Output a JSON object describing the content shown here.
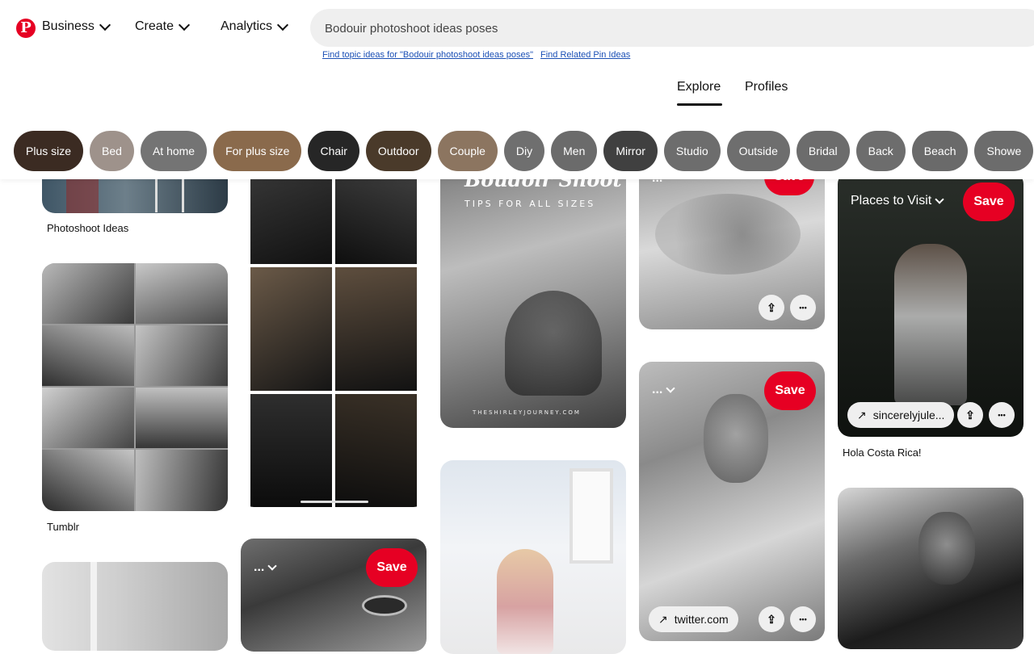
{
  "header": {
    "logo": "P",
    "nav": [
      {
        "label": "Business"
      },
      {
        "label": "Create"
      },
      {
        "label": "Analytics"
      }
    ],
    "search": {
      "value": "Bodouir photoshoot ideas poses"
    },
    "links": [
      "Find topic ideas for \"Bodouir photoshoot ideas poses\"",
      "Find Related Pin Ideas"
    ],
    "tabs": [
      "Explore",
      "Profiles"
    ]
  },
  "chips": [
    {
      "label": "Plus size",
      "color": "#3b2b22"
    },
    {
      "label": "Bed",
      "color": "#9e928b"
    },
    {
      "label": "At home",
      "color": "#747474"
    },
    {
      "label": "For plus size",
      "color": "#8a6a4c"
    },
    {
      "label": "Chair",
      "color": "#262626"
    },
    {
      "label": "Outdoor",
      "color": "#4a3a2a"
    },
    {
      "label": "Couple",
      "color": "#8c7560"
    },
    {
      "label": "Diy",
      "color": "#6f6f6f"
    },
    {
      "label": "Men",
      "color": "#6b6b6b"
    },
    {
      "label": "Mirror",
      "color": "#404040"
    },
    {
      "label": "Studio",
      "color": "#6d6d6d"
    },
    {
      "label": "Outside",
      "color": "#6e6e6e"
    },
    {
      "label": "Bridal",
      "color": "#6c6c6c"
    },
    {
      "label": "Back",
      "color": "#6d6d6d"
    },
    {
      "label": "Beach",
      "color": "#6a6a6a"
    },
    {
      "label": "Showe",
      "color": "#6c6c6c"
    }
  ],
  "pins": {
    "captions": {
      "photoshoot_ideas": "Photoshoot Ideas",
      "tumblr": "Tumblr",
      "hola": "Hola Costa Rica!"
    },
    "save_label": "Save",
    "board_label": "Places to Visit",
    "board_placeholder": "...",
    "sources": {
      "sincerely": "sincerelyjule...",
      "twitter": "twitter.com"
    },
    "overlay_text": {
      "title": "Boudoir Shoot",
      "subtitle": "TIPS FOR ALL SIZES",
      "credit": "THESHIRLEYJOURNEY.COM"
    },
    "more_glyph": "•••",
    "share_glyph": "⇪",
    "arrow_glyph": "↗"
  }
}
